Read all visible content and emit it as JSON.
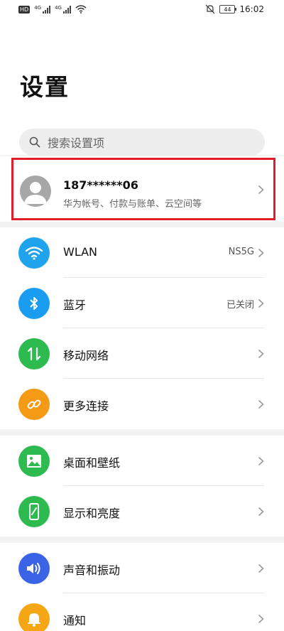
{
  "status_bar": {
    "signal_1": "4G",
    "signal_2": "4G",
    "hd": "HD",
    "battery": "44",
    "time": "16:02"
  },
  "title": "设置",
  "search": {
    "placeholder": "搜索设置项"
  },
  "account": {
    "name": "187******06",
    "subtitle": "华为帐号、付款与账单、云空间等"
  },
  "groups": [
    {
      "items": [
        {
          "label": "WLAN",
          "value": "NS5G",
          "icon": "wifi-icon",
          "color": "#1fa3ec"
        },
        {
          "label": "蓝牙",
          "value": "已关闭",
          "icon": "bluetooth-icon",
          "color": "#1a9cf0"
        },
        {
          "label": "移动网络",
          "value": "",
          "icon": "mobile-data-icon",
          "color": "#2dba4e"
        },
        {
          "label": "更多连接",
          "value": "",
          "icon": "link-icon",
          "color": "#f59a14"
        }
      ]
    },
    {
      "items": [
        {
          "label": "桌面和壁纸",
          "value": "",
          "icon": "wallpaper-icon",
          "color": "#2dba4e"
        },
        {
          "label": "显示和亮度",
          "value": "",
          "icon": "display-icon",
          "color": "#2dba4e"
        }
      ]
    },
    {
      "items": [
        {
          "label": "声音和振动",
          "value": "",
          "icon": "sound-icon",
          "color": "#3a63e6"
        },
        {
          "label": "通知",
          "value": "",
          "icon": "notification-icon",
          "color": "#f5a614"
        }
      ]
    }
  ]
}
